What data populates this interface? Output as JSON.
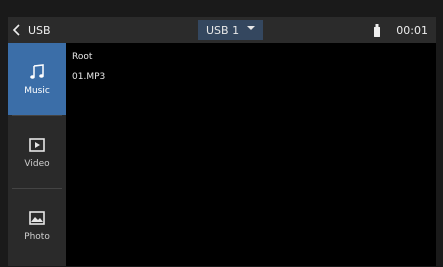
{
  "topbar": {
    "back_label": "USB",
    "source": "USB 1",
    "time": "00:01"
  },
  "sidebar": {
    "items": [
      {
        "label": "Music",
        "icon": "music-note-icon",
        "active": true
      },
      {
        "label": "Video",
        "icon": "video-play-icon",
        "active": false
      },
      {
        "label": "Photo",
        "icon": "photo-icon",
        "active": false
      }
    ]
  },
  "files": [
    {
      "name": "Root"
    },
    {
      "name": "01.MP3"
    }
  ],
  "colors": {
    "accent": "#3b6ea8",
    "topbar": "#2b2b2b",
    "sidebar": "#2a2a2a",
    "dropdown": "#34475f",
    "background": "#000000"
  }
}
